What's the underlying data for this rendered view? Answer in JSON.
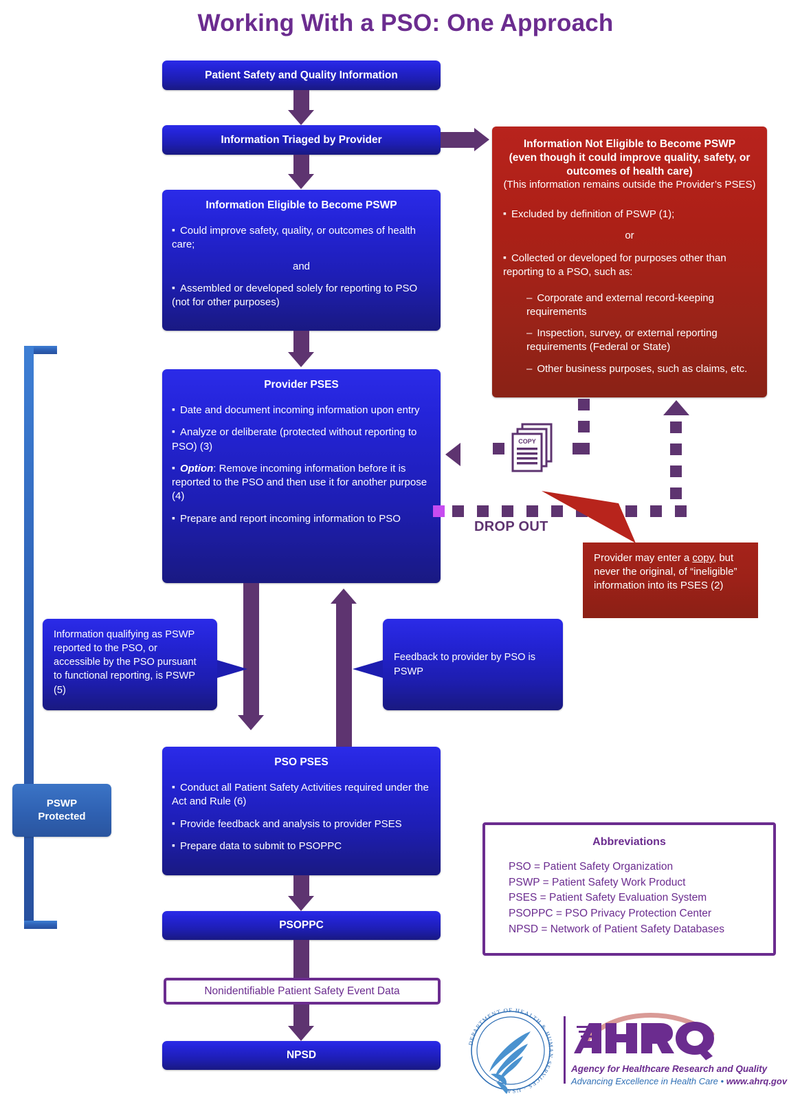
{
  "title": "Working With a PSO: One Approach",
  "colors": {
    "title_purple": "#6b2c8f",
    "arrow_purple": "#5e3470",
    "box_blue": "#2424d8",
    "box_red": "#a5231a",
    "bracket_blue": "#2f63b8",
    "dropout_magenta": "#c64cf0"
  },
  "nodes": {
    "patient_safety_info": {
      "label": "Patient Safety and Quality Information"
    },
    "triaged": {
      "label": "Information Triaged by Provider"
    },
    "eligible": {
      "title": "Information Eligible to Become PSWP",
      "bullets": [
        "Could improve safety, quality, or outcomes of health care;",
        "Assembled or developed solely for reporting to PSO (not for other purposes)"
      ],
      "conjunction": "and"
    },
    "not_eligible": {
      "heading_line1": "Information Not Eligible to Become PSWP",
      "heading_line2": "(even though it could improve quality, safety, or outcomes of health care)",
      "subheading": "(This information remains outside the Provider’s PSES)",
      "bullet1": "Excluded by definition of PSWP (1);",
      "conjunction": "or",
      "bullet2": "Collected or developed for purposes other than reporting to a PSO, such as:",
      "subitems": [
        "Corporate and external record-keeping requirements",
        "Inspection, survey, or external reporting requirements (Federal or State)",
        "Other business purposes, such as claims, etc."
      ]
    },
    "provider_pses": {
      "title": "Provider PSES",
      "bullets": [
        "Date and document incoming information upon entry",
        "Analyze or deliberate (protected without reporting to PSO) (3)",
        "Prepare and report incoming information to PSO"
      ],
      "option_label": "Option",
      "option_text": ": Remove incoming information before it is reported to the PSO and then use it for another purpose (4)"
    },
    "pso_pses": {
      "title": "PSO PSES",
      "bullets": [
        "Conduct all Patient Safety Activities required under the Act and Rule (6)",
        "Provide feedback and analysis to provider PSES",
        "Prepare data to submit to PSOPPC"
      ]
    },
    "psoppc": {
      "label": "PSOPPC"
    },
    "nonidentifiable": {
      "label": "Nonidentifiable Patient Safety Event Data"
    },
    "npsd": {
      "label": "NPSD"
    }
  },
  "callouts": {
    "reported_pswp": "Information qualifying as PSWP reported to the PSO, or accessible by the PSO pursuant to functional reporting, is PSWP (5)",
    "feedback": "Feedback to provider by PSO is PSWP",
    "copy_note_pre": "Provider may enter a ",
    "copy_note_underline": "copy",
    "copy_note_post": ", but never the original, of “ineligible” information into its PSES (2)"
  },
  "labels": {
    "drop_out": "DROP OUT",
    "pswp_protected_line1": "PSWP",
    "pswp_protected_line2": "Protected",
    "copy_icon_text": "COPY"
  },
  "abbreviations": {
    "title": "Abbreviations",
    "items": [
      "PSO = Patient Safety Organization",
      "PSWP = Patient Safety Work Product",
      "PSES = Patient Safety Evaluation System",
      "PSOPPC = PSO Privacy Protection Center",
      "NPSD = Network of Patient Safety Databases"
    ]
  },
  "logo": {
    "hhs_ring_text": "DEPARTMENT OF HEALTH & HUMAN SERVICES · USA",
    "ahrq_wordmark": "AHRQ",
    "tagline1": "Agency for Healthcare Research and Quality",
    "tagline2_pre": "Advancing Excellence in Health Care",
    "tagline2_sep": " • ",
    "tagline2_url": "www.ahrq.gov"
  }
}
